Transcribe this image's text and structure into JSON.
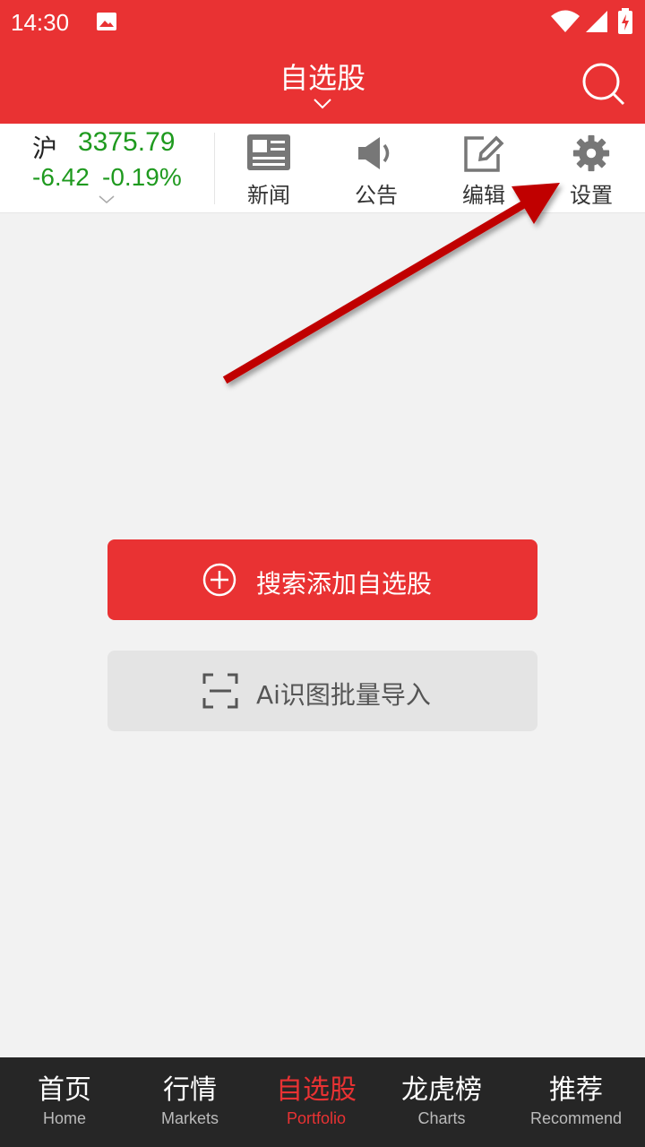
{
  "status_bar": {
    "time": "14:30",
    "icons": [
      "image-icon",
      "wifi-icon",
      "signal-icon",
      "battery-icon"
    ]
  },
  "header": {
    "title": "自选股",
    "icons": [
      "chevron-down-icon",
      "search-icon"
    ]
  },
  "index": {
    "name": "沪",
    "value": "3375.79",
    "change": "-6.42",
    "change_pct": "-0.19%"
  },
  "toolbar": [
    {
      "label": "新闻",
      "icon": "news-icon"
    },
    {
      "label": "公告",
      "icon": "speaker-icon"
    },
    {
      "label": "编辑",
      "icon": "edit-icon"
    },
    {
      "label": "设置",
      "icon": "gear-icon"
    }
  ],
  "actions": {
    "primary_label": "搜索添加自选股",
    "secondary_label": "Ai识图批量导入"
  },
  "bottom_nav": [
    {
      "zh": "首页",
      "en": "Home",
      "active": false
    },
    {
      "zh": "行情",
      "en": "Markets",
      "active": false
    },
    {
      "zh": "自选股",
      "en": "Portfolio",
      "active": true
    },
    {
      "zh": "龙虎榜",
      "en": "Charts",
      "active": false
    },
    {
      "zh": "推荐",
      "en": "Recommend",
      "active": false
    }
  ],
  "colors": {
    "brand_red": "#e93233",
    "down_green": "#1f9a1f",
    "nav_bg": "#262626",
    "annotation_arrow": "#c00000"
  }
}
